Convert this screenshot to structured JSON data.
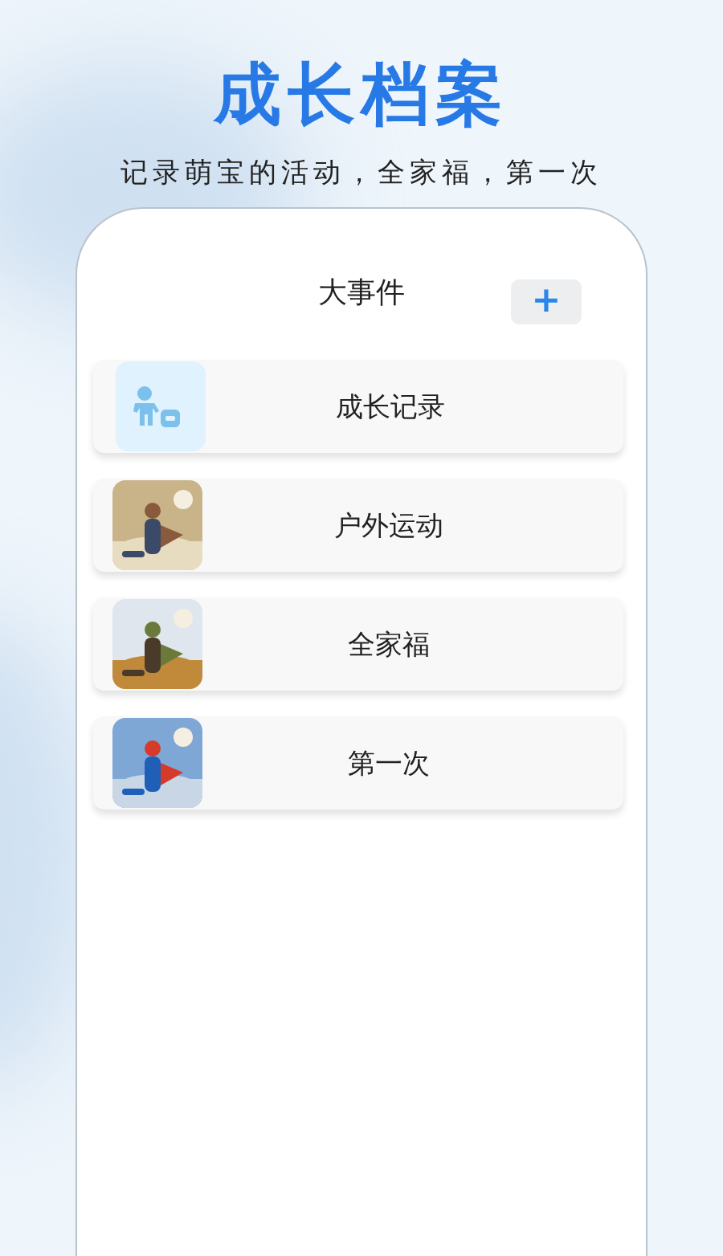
{
  "headline": "成长档案",
  "tagline": "记录萌宝的活动，全家福，第一次",
  "screen": {
    "title": "大事件",
    "add_button": "+",
    "items": [
      {
        "label": "成长记录",
        "kind": "icon"
      },
      {
        "label": "户外运动",
        "kind": "picture"
      },
      {
        "label": "全家福",
        "kind": "picture"
      },
      {
        "label": "第一次",
        "kind": "picture"
      }
    ]
  }
}
